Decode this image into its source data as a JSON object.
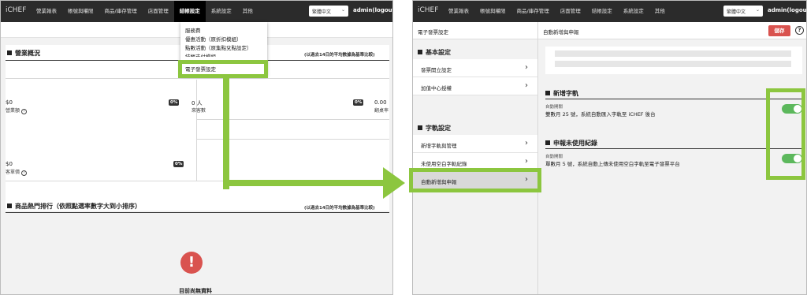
{
  "left_screen": {
    "brand": "iCHEF",
    "nav": [
      "營業報表",
      "帳號與權限",
      "商品/庫存管理",
      "店面管理",
      "結帳設定",
      "系統設定",
      "其他"
    ],
    "lang": "繁體中文",
    "admin": "admin(logout)",
    "dropdown": [
      "服務費",
      "優惠活動（原折扣模組）",
      "點數活動（原集點兌點設定）",
      "結帳支付模組",
      "電子發票設定"
    ],
    "overview_title": "營業概況",
    "overview_note": "(以過去14日的平均數據為基準比較)",
    "metrics": [
      {
        "value": "$0",
        "label": "營業額",
        "pct": "0%"
      },
      {
        "value": "0 人",
        "label": "來客數",
        "pct": "0%"
      },
      {
        "value": "0.00",
        "label": "翻桌率"
      },
      {
        "value": "$0",
        "label": "客單價",
        "pct": "0%"
      }
    ],
    "ranking_title": "商品熱門排行（依照點選率數字大到小排序）",
    "ranking_note": "(以過去14日的平均數據為基準比較)",
    "empty_icon": "!",
    "empty_text": "目前尚無資料"
  },
  "right_screen": {
    "brand": "iCHEF",
    "nav": [
      "營業報表",
      "帳號與權限",
      "商品/庫存管理",
      "店面管理",
      "結帳設定",
      "系統設定",
      "其他"
    ],
    "lang": "繁體中文",
    "admin": "admin(logout)",
    "left_header": "電子發票設定",
    "right_header": "自動新增與申報",
    "save": "儲存",
    "help": "?",
    "basic_title": "基本設定",
    "basic_items": [
      "發票開立設定",
      "加值中心授權"
    ],
    "track_title": "字軌設定",
    "track_items": [
      "新增字軌與管理",
      "未使用空白字軌紀錄",
      "自動新增與申報"
    ],
    "new_track": {
      "title": "新增字軌",
      "toggle_label": "自動開關",
      "desc": "雙數月 25 號，系統自動匯入字軌至 iCHEF 後台",
      "enabled": true
    },
    "report": {
      "title": "申報未使用紀錄",
      "toggle_label": "自動開關",
      "desc": "單數月 5 號，系統自動上傳未使用空白字軌至電子發票平台",
      "enabled": true
    }
  },
  "colors": {
    "highlight": "#8cc63f",
    "nav_bg": "#2b2b2b",
    "save_red": "#d9534f",
    "toggle_on": "#5cb85c"
  }
}
